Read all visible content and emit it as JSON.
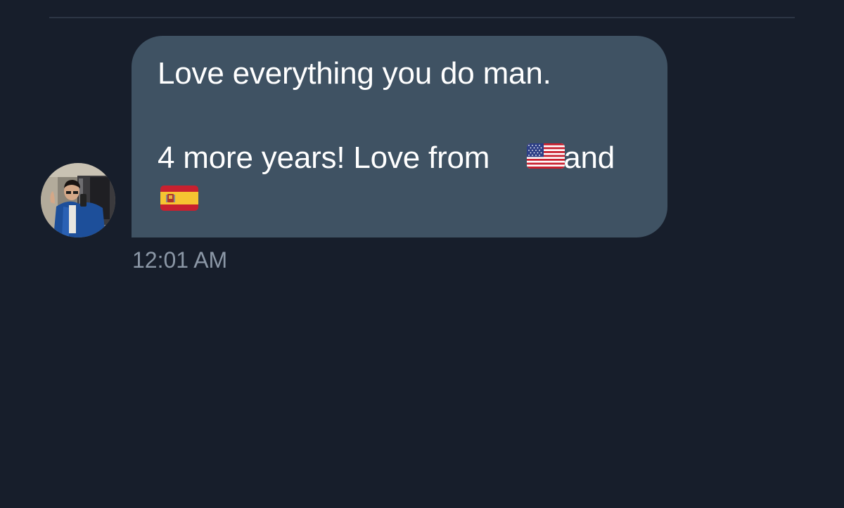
{
  "conversation": {
    "message": {
      "line1": "Love everything you do man.",
      "line2_text": "4 more years! Love from",
      "line2_after": "and",
      "flags": [
        "us-flag-icon",
        "spain-flag-icon"
      ],
      "timestamp": "12:01 AM"
    },
    "sender": {
      "avatar": "profile-photo"
    },
    "colors": {
      "background": "#171e2b",
      "bubble": "#3f5263",
      "text": "#ffffff",
      "timestamp": "#8b97a6",
      "divider": "#2c3544"
    }
  }
}
